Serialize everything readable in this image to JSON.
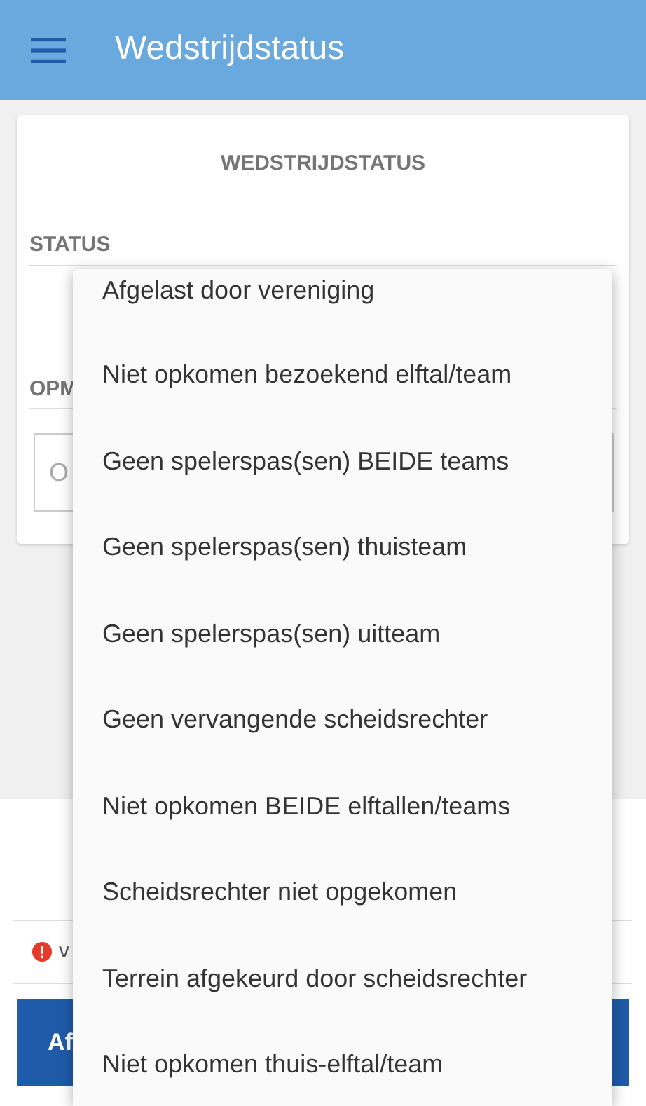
{
  "app_bar": {
    "title": "Wedstrijdstatus"
  },
  "card": {
    "heading": "WEDSTRIJDSTATUS",
    "status_label": "STATUS",
    "remark_label": "OPM",
    "remark_field": {
      "placeholder": "O"
    }
  },
  "footer": {
    "error_text": "v",
    "button": "Af"
  },
  "dropdown_menu": {
    "items": [
      {
        "label": "Afgelast door vereniging"
      },
      {
        "label": "Niet opkomen bezoekend elftal/team"
      },
      {
        "label": "Geen spelerspas(sen) BEIDE teams"
      },
      {
        "label": "Geen spelerspas(sen) thuisteam"
      },
      {
        "label": "Geen spelerspas(sen) uitteam"
      },
      {
        "label": "Geen vervangende scheidsrechter"
      },
      {
        "label": "Niet opkomen BEIDE elftallen/teams"
      },
      {
        "label": "Scheidsrechter niet opgekomen"
      },
      {
        "label": "Terrein afgekeurd door scheidsrechter"
      },
      {
        "label": "Niet opkomen thuis-elftal/team"
      }
    ]
  }
}
